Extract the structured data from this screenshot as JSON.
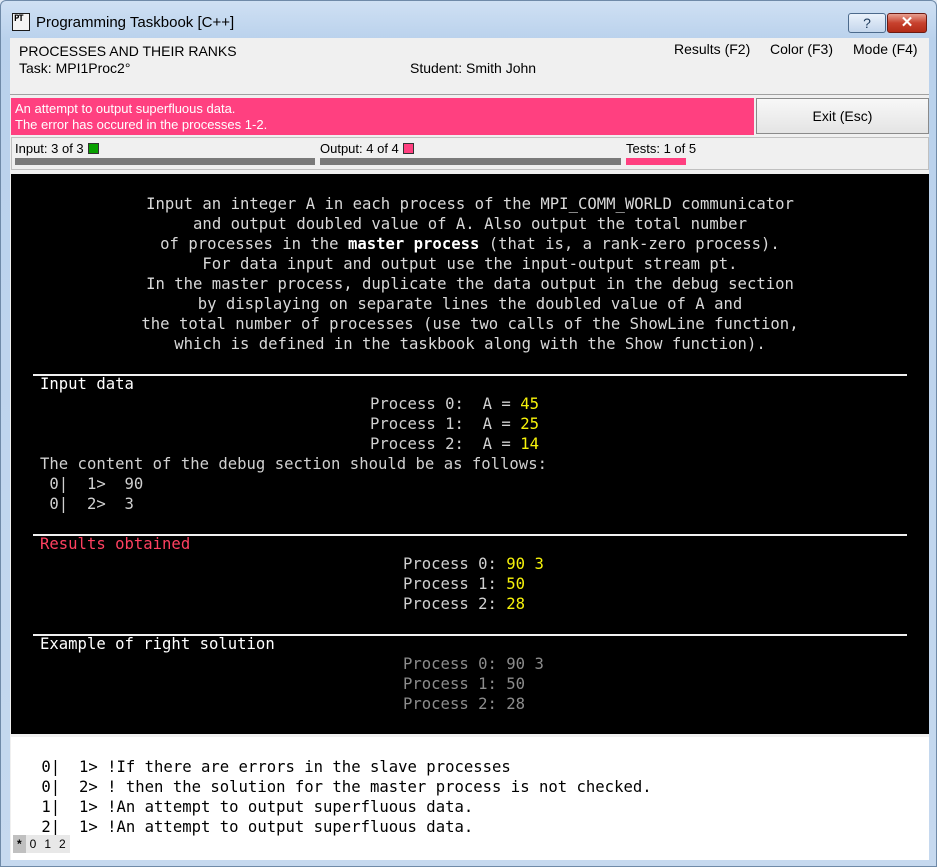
{
  "window": {
    "title": "Programming Taskbook [C++]",
    "app_icon_text": "PT",
    "help_label": "?",
    "close_label": "✕"
  },
  "header": {
    "task_title": "PROCESSES AND THEIR RANKS",
    "task_name": "Task: MPI1Proc2°",
    "student": "Student: Smith John",
    "menu": {
      "results": "Results (F2)",
      "color": "Color (F3)",
      "mode": "Mode (F4)"
    }
  },
  "error": {
    "line1": "An attempt to output superfluous data.",
    "line2": "The error has occured in the processes 1-2.",
    "exit_label": "Exit (Esc)",
    "color": "#ff4080"
  },
  "progress": {
    "input_label": "Input:  3 of 3",
    "output_label": "Output:  4 of 4",
    "tests_label": "Tests:  1 of 5",
    "tests_fraction": 0.2
  },
  "description": {
    "lines": [
      "Input an integer A in each process of the MPI_COMM_WORLD communicator",
      "and output doubled value of A. Also output the total number"
    ],
    "line3_pre": "of processes in the ",
    "line3_bold": "master process",
    "line3_post": " (that is, a rank-zero process).",
    "lines_after": [
      "For data input and output use the input-output stream pt.",
      "In the master process, duplicate the data output in the debug section",
      "by displaying on separate lines the doubled value of A and",
      "the total number of processes (use two calls of the ShowLine function,",
      "which is defined in the taskbook along with the Show function)."
    ]
  },
  "input_data": {
    "header": "Input data",
    "rows": [
      {
        "label": "Process 0:  A = ",
        "value": "45"
      },
      {
        "label": "Process 1:  A = ",
        "value": "25"
      },
      {
        "label": "Process 2:  A = ",
        "value": "14"
      }
    ],
    "debug_note": "The content of the debug section should be as follows:",
    "debug_rows": [
      " 0|  1>  90",
      " 0|  2>  3"
    ]
  },
  "results": {
    "header": "Results obtained",
    "rows": [
      {
        "label": "Process 0: ",
        "value": "90 3"
      },
      {
        "label": "Process 1: ",
        "value": "50"
      },
      {
        "label": "Process 2: ",
        "value": "28"
      }
    ]
  },
  "example": {
    "header": "Example of right solution",
    "rows": [
      {
        "label": "Process 0: ",
        "value": "90 3"
      },
      {
        "label": "Process 1: ",
        "value": "50"
      },
      {
        "label": "Process 2: ",
        "value": "28"
      }
    ]
  },
  "debug": {
    "lines": [
      " 0|  1> !If there are errors in the slave processes",
      " 0|  2> ! then the solution for the master process is not checked.",
      " 1|  1> !An attempt to output superfluous data.",
      " 2|  1> !An attempt to output superfluous data."
    ],
    "tabs": [
      "*",
      "0",
      "1",
      "2"
    ]
  }
}
